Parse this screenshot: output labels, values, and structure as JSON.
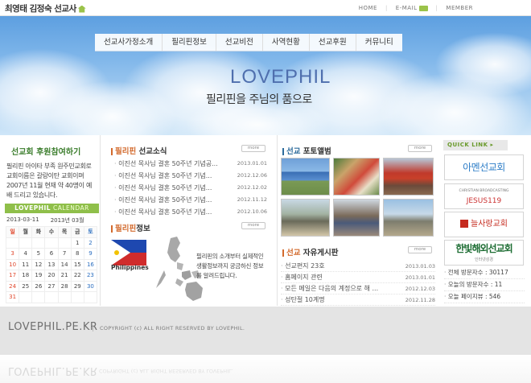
{
  "header": {
    "logo_text": "최영태 김정숙 선교사",
    "util_links": [
      "HOME",
      "E-MAIL",
      "MEMBER"
    ]
  },
  "nav": {
    "items": [
      "선교사가정소개",
      "필리핀정보",
      "선교비전",
      "사역현황",
      "선교후원",
      "커뮤니티"
    ]
  },
  "hero": {
    "brand": "LOVEPHIL",
    "slogan": "필리핀을 주님의 품으로"
  },
  "support": {
    "title": "선교회 후원참여하기",
    "intro": "필리핀 아이타 부족 원주민교회로 교회이름은 갈랑이탄 교회이며 2007년 11월 현재 약 40명이 예배 드리고 있습니다."
  },
  "calendar": {
    "bar_brand": "LOVEPHIL",
    "bar_title": "CALENDAR",
    "current_date": "2013-03-11",
    "year_month": "2013년 03월",
    "weekdays": [
      "일",
      "월",
      "화",
      "수",
      "목",
      "금",
      "토"
    ],
    "weeks": [
      [
        "",
        "",
        "",
        "",
        "",
        "1",
        "2"
      ],
      [
        "3",
        "4",
        "5",
        "6",
        "7",
        "8",
        "9"
      ],
      [
        "10",
        "11",
        "12",
        "13",
        "14",
        "15",
        "16"
      ],
      [
        "17",
        "18",
        "19",
        "20",
        "21",
        "22",
        "23"
      ],
      [
        "24",
        "25",
        "26",
        "27",
        "28",
        "29",
        "30"
      ],
      [
        "31",
        "",
        "",
        "",
        "",
        "",
        ""
      ]
    ]
  },
  "news": {
    "title_hl": "필리핀",
    "title": "선교소식",
    "more": "more",
    "items": [
      {
        "title": "이진선 목사님 결혼 50주년 기념공...",
        "date": "2013.01.01"
      },
      {
        "title": "이진선 목사님 결혼 50주년 기념...",
        "date": "2012.12.06"
      },
      {
        "title": "이진선 목사님 결혼 50주년 기념...",
        "date": "2012.12.02"
      },
      {
        "title": "이진선 목사님 결혼 50주년 기념...",
        "date": "2012.11.12"
      },
      {
        "title": "이진선 목사님 결혼 50주년 기념...",
        "date": "2012.10.06"
      }
    ]
  },
  "info": {
    "title_hl": "필리핀",
    "title": "정보",
    "more": "more",
    "flag_label": "Philippines",
    "text": "필리핀의 소개부터 실제적인 생활정보까지 궁금하신 정보를 알려드립니다."
  },
  "album": {
    "title_hl": "선교",
    "title": "포토앨범",
    "more": "more"
  },
  "board": {
    "title_hl": "선교",
    "title": "자유게시판",
    "more": "more",
    "items": [
      {
        "title": "선교편지 23호",
        "date": "2013.01.03"
      },
      {
        "title": "홈페이지 관련",
        "date": "2013.01.01"
      },
      {
        "title": "모든 메일은 다음의 계정으로 해 ...",
        "date": "2012.12.03"
      },
      {
        "title": "성탄절 10계명",
        "date": "2012.11.28"
      }
    ]
  },
  "quicklinks": {
    "title": "QUICK LINK",
    "items": [
      "아멘선교회",
      "JESUS119",
      "늘사랑교회",
      "한빛해외선교회"
    ],
    "sub_broadcast": "CHRISTIAN BROADCASTING",
    "sub_hanbit": "인터넷성경"
  },
  "stats": {
    "total": "전체 방문자수 : 30117",
    "today": "오늘의 방문자수 : 11",
    "pageviews": "오늘 페이지뷰 : 546"
  },
  "footer": {
    "logo": "LOVEPHIL.PE.KR",
    "copyright": "COPYRIGHT (c) ALL RIGHT RESERVED BY LOVEPHIL."
  },
  "colors": {
    "accent_green": "#8fbf4a",
    "accent_orange": "#d36a2d",
    "title_blue": "#2e6c9c",
    "brand_blue": "#4f6fae"
  }
}
